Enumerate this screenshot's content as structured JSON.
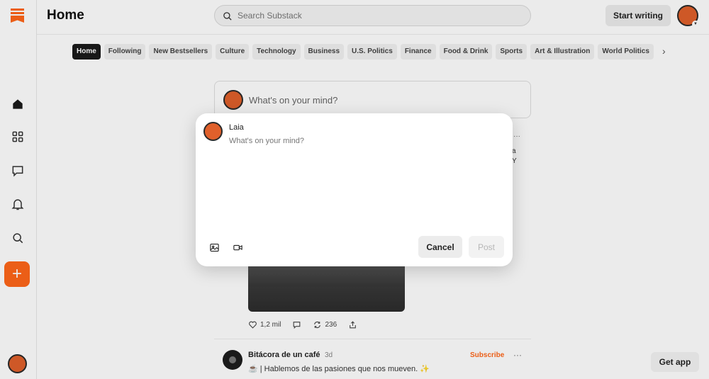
{
  "header": {
    "title": "Home",
    "search_placeholder": "Search Substack",
    "start_writing": "Start writing"
  },
  "sidebar": {
    "items": [
      {
        "icon": "home-icon"
      },
      {
        "icon": "grid-icon"
      },
      {
        "icon": "chat-icon"
      },
      {
        "icon": "bell-icon"
      },
      {
        "icon": "search-icon"
      },
      {
        "icon": "plus-icon"
      }
    ],
    "plus_label": "+"
  },
  "categories": [
    "Home",
    "Following",
    "New Bestsellers",
    "Culture",
    "Technology",
    "Business",
    "U.S. Politics",
    "Finance",
    "Food & Drink",
    "Sports",
    "Art & Illustration",
    "World Politics"
  ],
  "composer": {
    "placeholder": "What's on your mind?"
  },
  "post_actions": {
    "likes": "1,2 mil",
    "restacks": "236"
  },
  "feed_card": {
    "name": "Bitácora de un café",
    "time": "3d",
    "subscribe": "Subscribe",
    "dots": "···",
    "text": "☕ | Hablemos de las pasiones que nos mueven. ✨"
  },
  "background_fragments": {
    "dots": "···",
    "line1": "a",
    "line2": "Y"
  },
  "get_app": "Get app",
  "modal": {
    "username": "Laia",
    "placeholder": "What's on your mind?",
    "cancel": "Cancel",
    "post": "Post"
  },
  "colors": {
    "brand": "#ff6719",
    "dark": "#1b1b1b"
  }
}
